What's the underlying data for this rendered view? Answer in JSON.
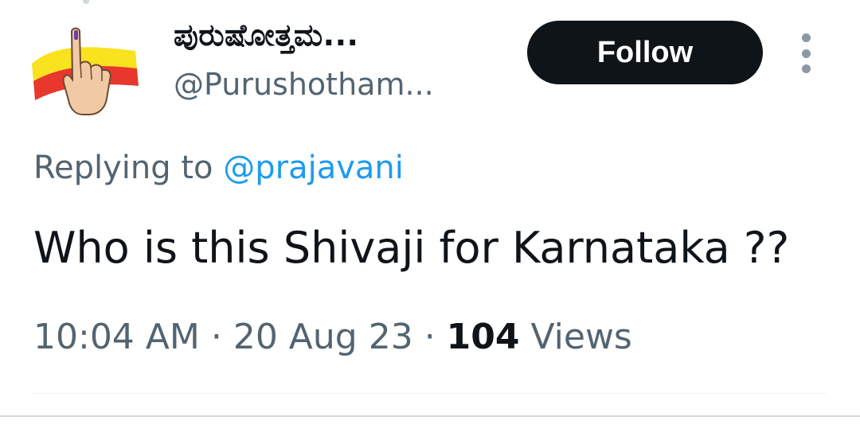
{
  "author": {
    "display_name": "ಪುರುಷೋತ್ತಮ...",
    "handle": "@Purushotham...",
    "avatar_icon": "karnataka-flag-voting-finger-icon",
    "avatar_colors": {
      "flag_yellow": "#f9e21e",
      "flag_red": "#e8372c",
      "skin": "#f1c9a5",
      "ink_mark": "#6a3fb5"
    }
  },
  "follow_button": {
    "label": "Follow"
  },
  "more_icon": "more-vertical-icon",
  "reply": {
    "prefix": "Replying to ",
    "handle": "@prajavani"
  },
  "tweet": {
    "text": "Who is this Shivaji for Karnataka ??"
  },
  "meta": {
    "time": "10:04 AM",
    "separator": " · ",
    "date": "20 Aug 23",
    "views_count": "104",
    "views_label": " Views"
  },
  "colors": {
    "text_primary": "#0f1419",
    "text_secondary": "#536471",
    "link": "#1d9bf0",
    "button_bg": "#0f1419",
    "button_text": "#ffffff"
  }
}
